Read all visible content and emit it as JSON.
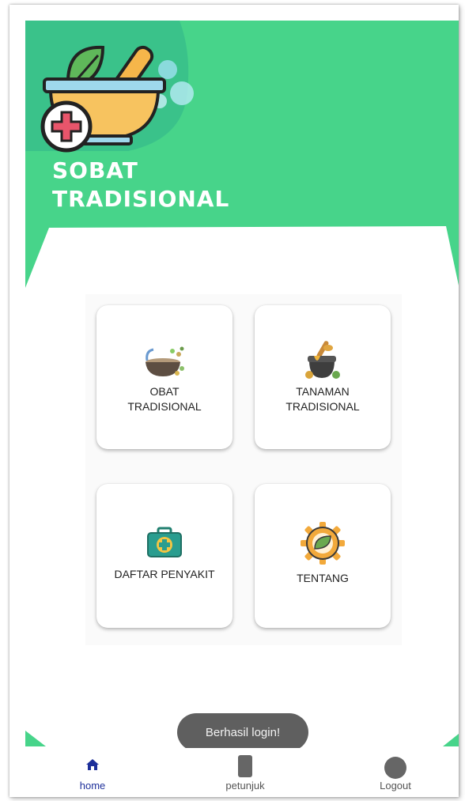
{
  "app": {
    "title_line1": "SOBAT",
    "title_line2": "TRADISIONAL"
  },
  "theme": {
    "primary": "#47d48a",
    "nav_active": "#1d2f9a",
    "toast_bg": "#5f5f5f"
  },
  "menu": [
    {
      "label": "OBAT\nTRADISIONAL",
      "icon": "mortar-herbs-icon"
    },
    {
      "label": "TANAMAN\nTRADISIONAL",
      "icon": "honey-pot-icon"
    },
    {
      "label": "DAFTAR PENYAKIT",
      "icon": "first-aid-kit-icon"
    },
    {
      "label": "TENTANG",
      "icon": "gear-leaf-icon"
    }
  ],
  "toast": {
    "text": "Berhasil login!"
  },
  "bottom_nav": [
    {
      "label": "home",
      "icon": "home-icon",
      "active": true
    },
    {
      "label": "petunjuk",
      "icon": "phone-icon",
      "active": false
    },
    {
      "label": "Logout",
      "icon": "circle-icon",
      "active": false
    }
  ]
}
